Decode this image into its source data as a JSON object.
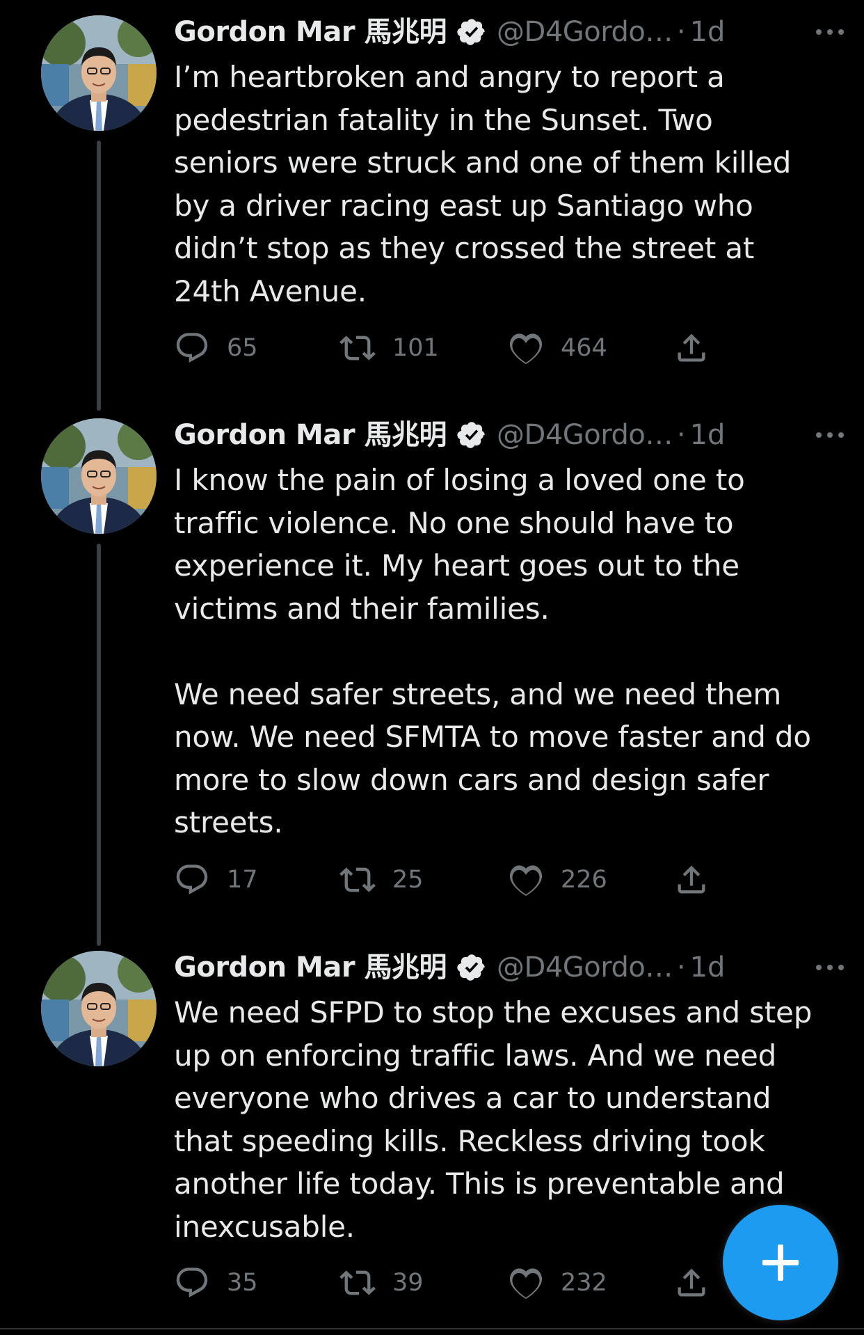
{
  "author": {
    "name": "Gordon Mar 馬兆明",
    "handle": "@D4Gordo…",
    "separator": "·"
  },
  "tweets": [
    {
      "time": "1d",
      "text": "I’m heartbroken and angry to report a pedestrian fatality in the Sunset. Two seniors were struck and one of them killed by a driver racing east up Santiago who didn’t stop as they crossed the street at 24th Avenue.",
      "replies": "65",
      "retweets": "101",
      "likes": "464"
    },
    {
      "time": "1d",
      "text": "I know the pain of losing a loved one to traffic violence. No one should have to experience it. My heart goes out to the victims and their families.\n\nWe need safer streets, and we need them now. We need SFMTA to move faster and do more to slow down cars and design safer streets.",
      "replies": "17",
      "retweets": "25",
      "likes": "226"
    },
    {
      "time": "1d",
      "text": "We need SFPD to stop the excuses and step up on enforcing traffic laws. And we need everyone who drives a car to understand that speeding kills. Reckless driving took another life today. This is preventable and inexcusable.",
      "replies": "35",
      "retweets": "39",
      "likes": "232"
    }
  ],
  "icons": {
    "verified": "verified-badge-icon",
    "more": "more-dots-icon",
    "reply": "reply-bubble-icon",
    "retweet": "retweet-arrows-icon",
    "like": "heart-icon",
    "share": "share-upload-icon",
    "compose": "plus-icon"
  },
  "colors": {
    "background": "#000000",
    "text": "#e7e9ea",
    "secondary": "#71767b",
    "accent": "#1d9bf0",
    "thread_line": "#3a3f44"
  }
}
